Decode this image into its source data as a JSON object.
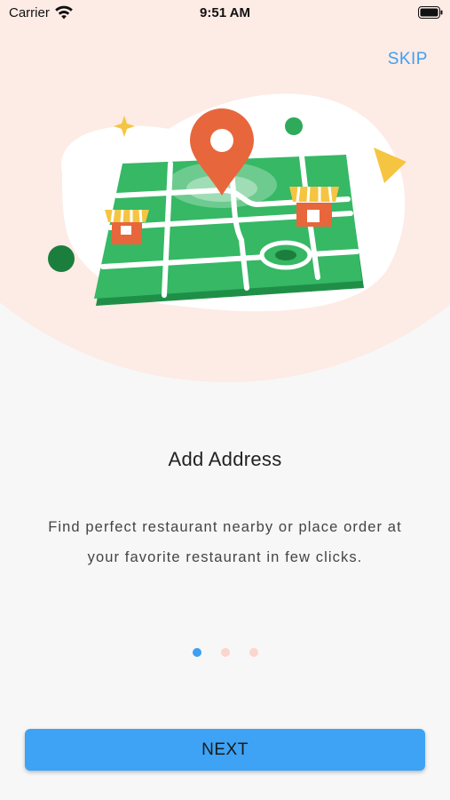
{
  "status_bar": {
    "carrier": "Carrier",
    "time": "9:51 AM"
  },
  "onboarding": {
    "skip_label": "SKIP",
    "title": "Add Address",
    "description": "Find perfect restaurant nearby or  place order at your favorite restaurant in few clicks.",
    "current_page": 1,
    "total_pages": 3,
    "next_label": "NEXT"
  },
  "colors": {
    "accent": "#3f9ff0",
    "hero_background": "#fdebe5",
    "map_green": "#2eaa5a",
    "pin_orange": "#e8663c",
    "dot_inactive": "#fbd6cc"
  }
}
